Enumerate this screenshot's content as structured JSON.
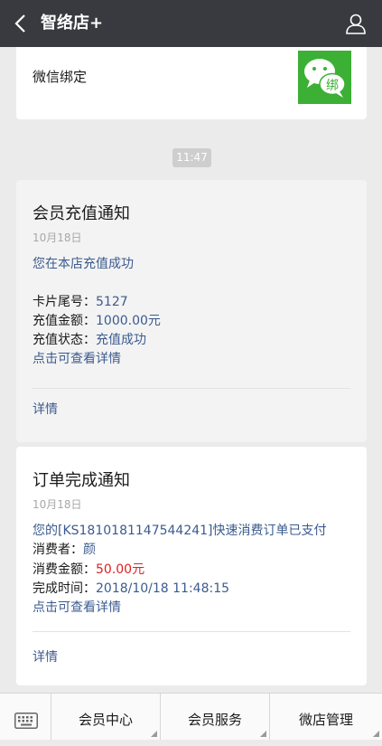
{
  "header": {
    "title": "智络店+"
  },
  "bind_card": {
    "label": "微信绑定",
    "logo_char": "绑"
  },
  "time_label": "11:47",
  "card1": {
    "title": "会员充值通知",
    "date": "10月18日",
    "intro": "您在本店充值成功",
    "card_no_label": "卡片尾号：",
    "card_no_value": "5127",
    "amount_label": "充值金额：",
    "amount_value": "1000.00元",
    "status_label": "充值状态：",
    "status_value": "充值成功",
    "view_detail": "点击可查看详情",
    "detail_link": "详情"
  },
  "card2": {
    "title": "订单完成通知",
    "date": "10月18日",
    "intro": "您的[KS1810181147544241]快速消费订单已支付",
    "consumer_label": "消费者：",
    "consumer_value": "颜",
    "amount_label": "消费金额：",
    "amount_value": "50.00元",
    "time_label": "完成时间：",
    "time_value": "2018/10/18 11:48:15",
    "view_detail": "点击可查看详情",
    "detail_link": "详情"
  },
  "bottom_menu": [
    {
      "label": "会员中心"
    },
    {
      "label": "会员服务"
    },
    {
      "label": "微店管理"
    }
  ],
  "colors": {
    "nav_bg": "#393a3f",
    "link_blue": "#3b5b8f",
    "price_red": "#e02020",
    "wechat_green": "#3cb034"
  }
}
